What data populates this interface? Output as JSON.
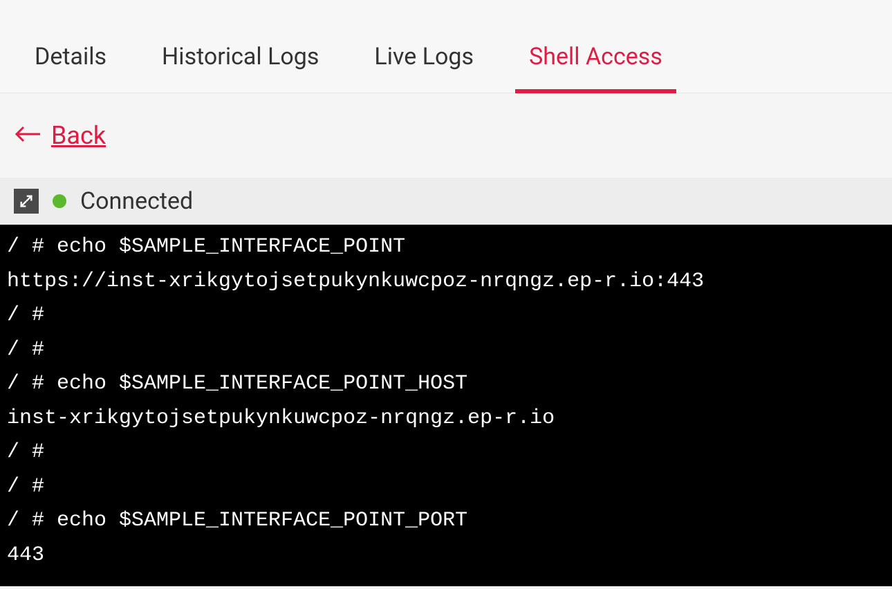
{
  "tabs": [
    {
      "label": "Details",
      "active": false
    },
    {
      "label": "Historical Logs",
      "active": false
    },
    {
      "label": "Live Logs",
      "active": false
    },
    {
      "label": "Shell Access",
      "active": true
    }
  ],
  "back": {
    "label": "Back"
  },
  "status": {
    "label": "Connected",
    "color": "#5cb82c"
  },
  "terminal": {
    "lines": [
      "/ # echo $SAMPLE_INTERFACE_POINT",
      "https://inst-xrikgytojsetpukynkuwcpoz-nrqngz.ep-r.io:443",
      "/ #",
      "/ #",
      "/ # echo $SAMPLE_INTERFACE_POINT_HOST",
      "inst-xrikgytojsetpukynkuwcpoz-nrqngz.ep-r.io",
      "/ #",
      "/ #",
      "/ # echo $SAMPLE_INTERFACE_POINT_PORT",
      "443"
    ]
  }
}
